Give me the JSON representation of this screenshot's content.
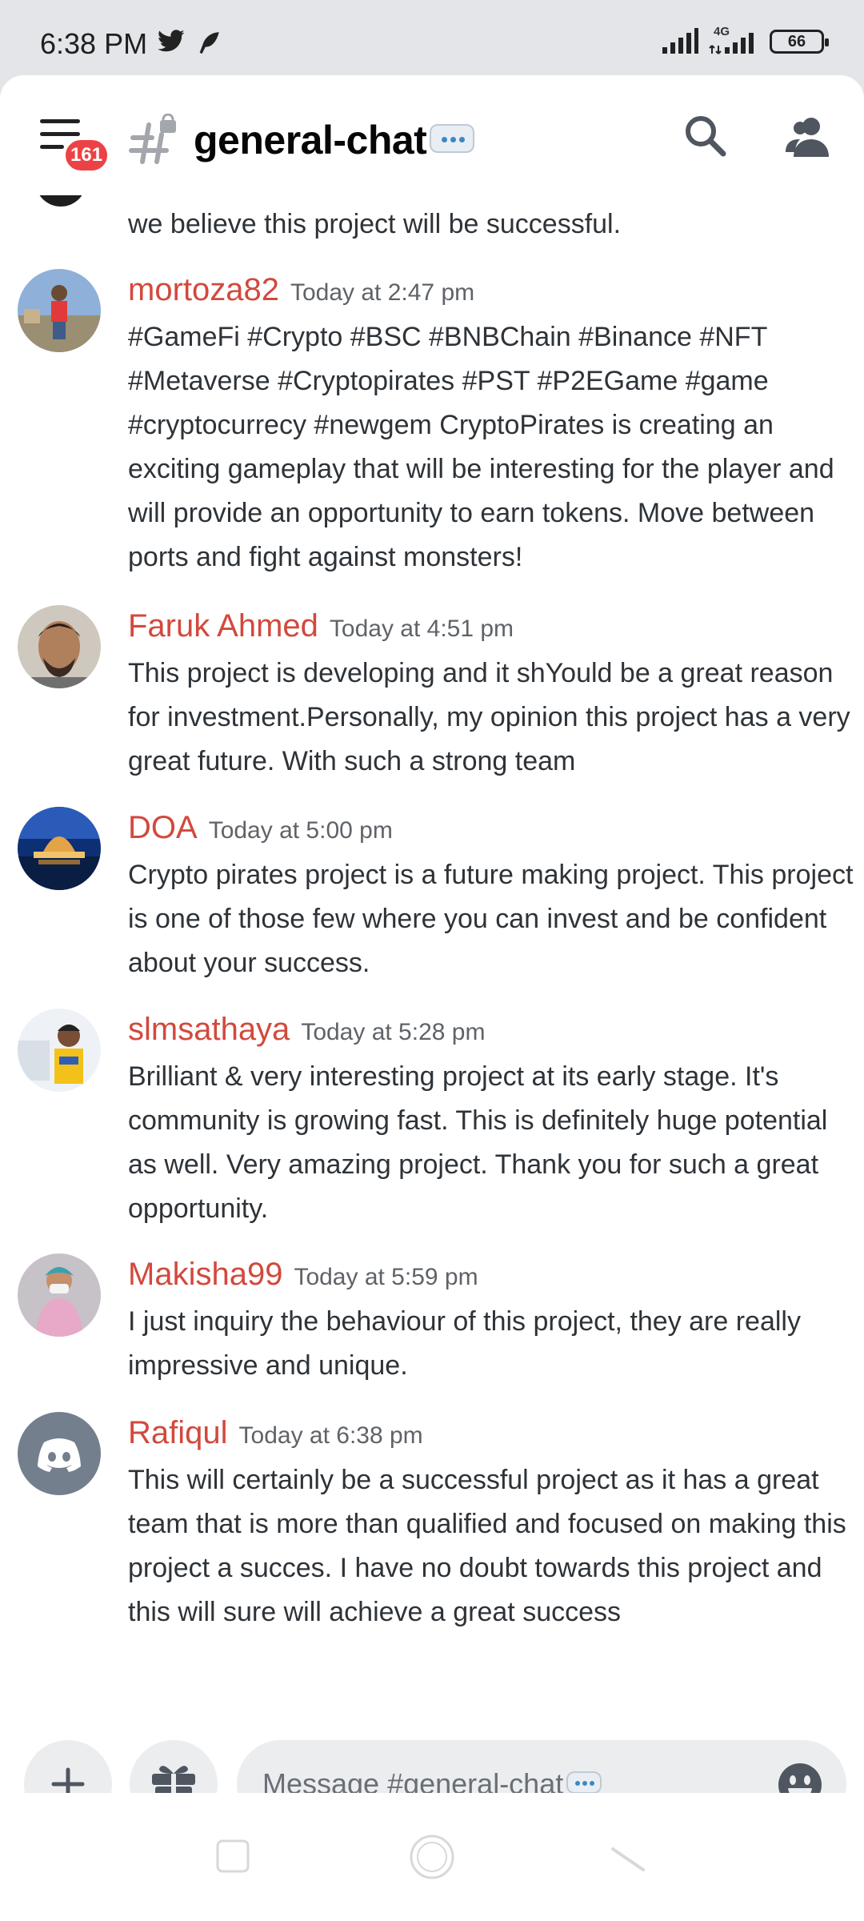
{
  "status_bar": {
    "time": "6:38 PM",
    "network": "4G",
    "battery": "66"
  },
  "header": {
    "notification_count": "161",
    "channel_name": "general-chat"
  },
  "messages": [
    {
      "username": "",
      "timestamp": "",
      "text": "This great project has a very strong and professional team, we believe this project will be successful."
    },
    {
      "username": "mortoza82",
      "timestamp": "Today at 2:47 pm",
      "text": "#GameFi #Crypto #BSC #BNBChain #Binance   #NFT #Metaverse #Cryptopirates #PST #P2EGame #game #cryptocurrecy #newgem  CryptoPirates is creating an exciting gameplay that will be interesting for the player and will provide an opportunity to earn tokens. Move between ports and fight against monsters!"
    },
    {
      "username": "Faruk Ahmed",
      "timestamp": "Today at 4:51 pm",
      "text": "This project is developing and it shYould be a great reason for investment.Personally, my opinion this project has a very great future. With such a strong team"
    },
    {
      "username": "DOA",
      "timestamp": "Today at 5:00 pm",
      "text": "Crypto pirates project is a future making project. This project is one of those few where you can invest and be confident about your success."
    },
    {
      "username": "slmsathaya",
      "timestamp": "Today at 5:28 pm",
      "text": "Brilliant & very interesting project at its early stage. It's community is growing fast. This is definitely huge potential as well. Very amazing project. Thank you for such a great opportunity."
    },
    {
      "username": "Makisha99",
      "timestamp": "Today at 5:59 pm",
      "text": "I just  inquiry the behaviour of this project, they are really impressive and unique."
    },
    {
      "username": "Rafiqul",
      "timestamp": "Today at 6:38 pm",
      "text": "This will certainly be a successful project as it has a great team that is more than qualified and focused on making this project a succes. I have no doubt towards this project and this will sure will achieve a great success"
    }
  ],
  "composer": {
    "placeholder": "Message #general-chat"
  },
  "colors": {
    "username": "#d2493d",
    "badge": "#ed4245",
    "discord_blurple_grey": "#747f8d"
  },
  "icons": [
    "hamburger-menu-icon",
    "channel-hash-locked-icon",
    "search-icon",
    "members-icon",
    "plus-icon",
    "gift-icon",
    "emoji-icon",
    "discord-logo-icon"
  ]
}
